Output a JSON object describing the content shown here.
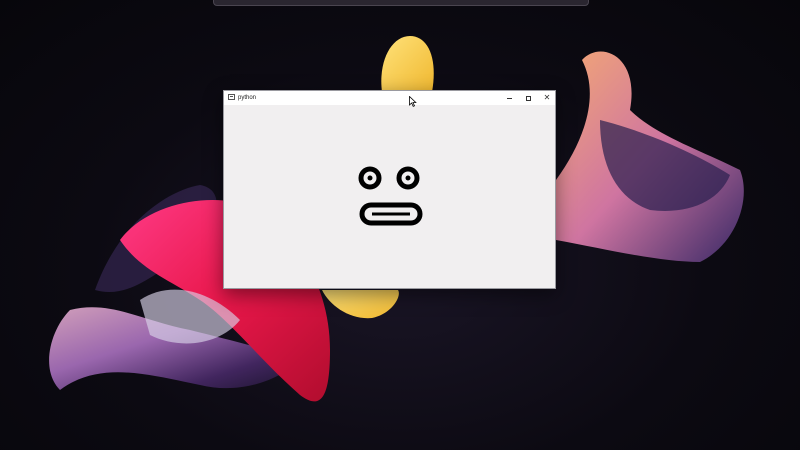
{
  "window": {
    "title": "python",
    "close_glyph": "✕"
  },
  "icons": [
    "app-icon",
    "minimize-icon",
    "maximize-icon",
    "close-icon",
    "cursor-icon"
  ],
  "colors": {
    "desktop_bg": "#0c0a12",
    "window_bg": "#f1eff0",
    "face": "#000000"
  }
}
